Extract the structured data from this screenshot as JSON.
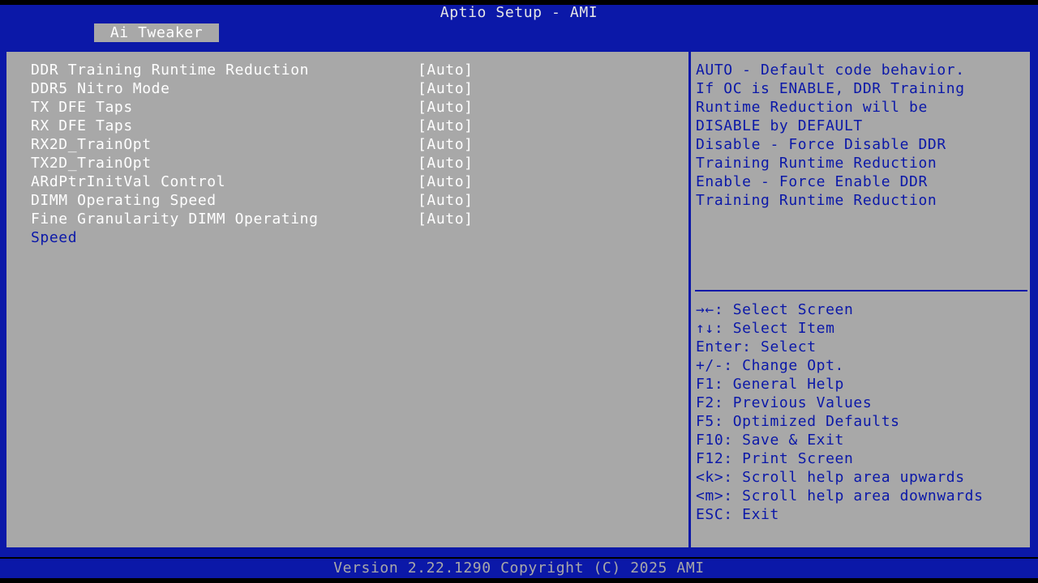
{
  "header": {
    "title": "Aptio Setup - AMI",
    "active_tab": "Ai Tweaker"
  },
  "settings": [
    {
      "label": "DDR Training Runtime Reduction",
      "value": "[Auto]"
    },
    {
      "label": "DDR5 Nitro Mode",
      "value": "[Auto]"
    },
    {
      "label": "TX DFE Taps",
      "value": "[Auto]"
    },
    {
      "label": "RX DFE Taps",
      "value": "[Auto]"
    },
    {
      "label": "RX2D_TrainOpt",
      "value": "[Auto]"
    },
    {
      "label": "TX2D_TrainOpt",
      "value": "[Auto]"
    },
    {
      "label": "ARdPtrInitVal Control",
      "value": "[Auto]"
    },
    {
      "label": "DIMM Operating Speed",
      "value": "[Auto]"
    },
    {
      "label": "Fine Granularity DIMM Operating",
      "value": "[Auto]",
      "label_cont": "Speed"
    }
  ],
  "help_text": [
    "AUTO - Default code behavior.",
    "If OC is ENABLE, DDR Training",
    "Runtime Reduction will be",
    "DISABLE by DEFAULT",
    "Disable - Force Disable DDR",
    "Training Runtime Reduction",
    "Enable - Force Enable DDR",
    "Training Runtime Reduction"
  ],
  "key_help": [
    "→←: Select Screen",
    "↑↓: Select Item",
    "Enter: Select",
    "+/-: Change Opt.",
    "F1: General Help",
    "F2: Previous Values",
    "F5: Optimized Defaults",
    "F10: Save & Exit",
    "F12: Print Screen",
    "<k>: Scroll help area upwards",
    "<m>: Scroll help area downwards",
    "ESC: Exit"
  ],
  "footer": {
    "text": "Version 2.22.1290 Copyright (C) 2025 AMI"
  },
  "colors": {
    "bios_blue": "#0b18a8",
    "panel_gray": "#a8a8a8",
    "highlight_white": "#ffffff"
  }
}
